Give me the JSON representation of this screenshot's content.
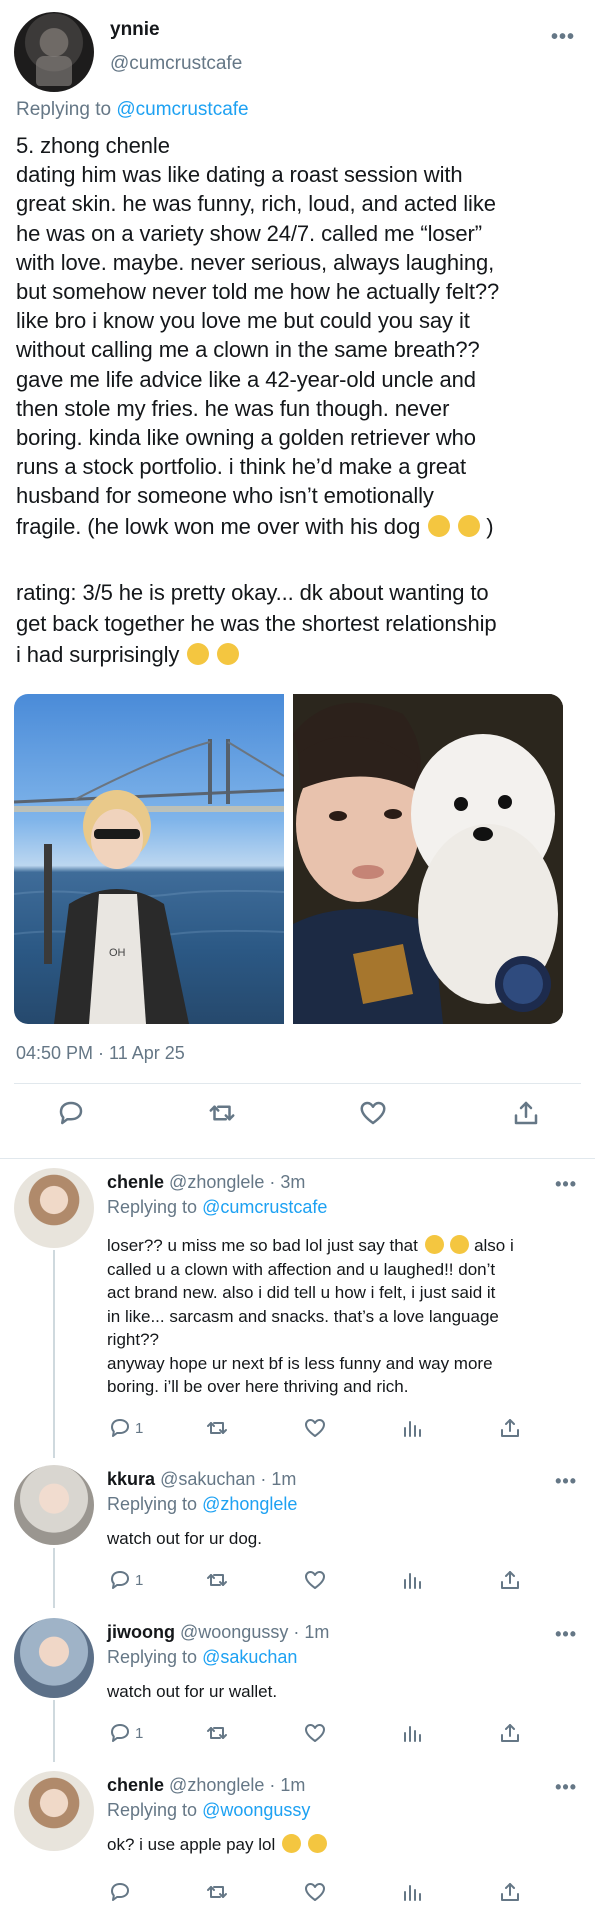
{
  "main_tweet": {
    "display_name": "ynnie",
    "handle": "@cumcrustcafe",
    "replying_prefix": "Replying to ",
    "replying_to": "@cumcrustcafe",
    "body_lines": [
      "5. zhong chenle",
      "dating him was like dating a roast session with",
      "great skin. he was funny, rich, loud, and acted like",
      "he was on a variety show 24/7. called me “loser”",
      "with love. maybe. never serious, always laughing,",
      "but somehow never told me how he actually felt??",
      "like bro i know you love me but could you say it",
      "without calling me a clown in the same breath??",
      "gave me life advice like a 42-year-old uncle and",
      "then stole my fries. he was fun though. never",
      "boring. kinda like owning a golden retriever who",
      "runs a stock portfolio. i think he’d make a great",
      "husband for someone who isn’t emotionally"
    ],
    "body_last_line": "fragile. (he lowk won me over with his dog",
    "body_last_line_end": ")",
    "rating_lines": [
      "rating: 3/5 he is pretty okay... dk about wanting to",
      "get back together he was the shortest relationship"
    ],
    "rating_last_line": "i had surprisingly",
    "timestamp": "04:50 PM · 11 Apr 25",
    "icons": [
      "reply-icon",
      "retweet-icon",
      "like-icon",
      "share-icon"
    ]
  },
  "replies": [
    {
      "name": "chenle",
      "meta": "@zhonglele · 3m",
      "replying_prefix": "Replying to ",
      "replying_to": "@cumcrustcafe",
      "lines": [
        "also i",
        "called u a clown with affection and u laughed!! don’t",
        "act brand new. also i did tell u how i felt, i just said it",
        "in like... sarcasm and snacks. that’s a love language",
        "right??",
        "anyway hope ur next bf is less funny and way more",
        "boring. i’ll be over here thriving and rich."
      ],
      "first_line_start": "loser?? u miss me so bad lol just say that",
      "reply_count": "1"
    },
    {
      "name": "kkura",
      "meta": "@sakuchan · 1m",
      "replying_prefix": "Replying to ",
      "replying_to": "@zhonglele",
      "text": "watch out for ur dog.",
      "reply_count": "1"
    },
    {
      "name": "jiwoong",
      "meta": "@woongussy · 1m",
      "replying_prefix": "Replying to ",
      "replying_to": "@sakuchan",
      "text": "watch out for ur wallet.",
      "reply_count": "1"
    },
    {
      "name": "chenle",
      "meta": "@zhonglele · 1m",
      "replying_prefix": "Replying to ",
      "replying_to": "@woongussy",
      "text": "ok? i use apple pay lol"
    }
  ],
  "colors": {
    "link": "#1da1f2",
    "secondary": "#657786",
    "text": "#14171a",
    "divider": "#e1e8ed"
  }
}
